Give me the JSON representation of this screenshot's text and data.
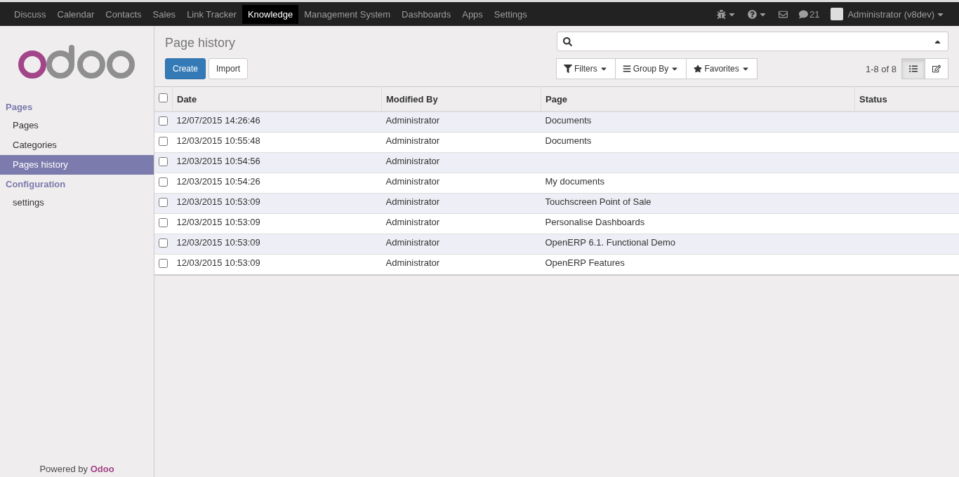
{
  "menu": [
    {
      "label": "Discuss",
      "selected": false
    },
    {
      "label": "Calendar",
      "selected": false
    },
    {
      "label": "Contacts",
      "selected": false
    },
    {
      "label": "Sales",
      "selected": false
    },
    {
      "label": "Link Tracker",
      "selected": false
    },
    {
      "label": "Knowledge",
      "selected": true
    },
    {
      "label": "Management System",
      "selected": false
    },
    {
      "label": "Dashboards",
      "selected": false
    },
    {
      "label": "Apps",
      "selected": false
    },
    {
      "label": "Settings",
      "selected": false
    }
  ],
  "systray": {
    "message_count": "21",
    "user": "Administrator (v8dev)"
  },
  "sidebar": {
    "sections": [
      {
        "title": "Pages",
        "items": [
          {
            "label": "Pages",
            "selected": false
          },
          {
            "label": "Categories",
            "selected": false
          },
          {
            "label": "Pages history",
            "selected": true
          }
        ]
      },
      {
        "title": "Configuration",
        "items": [
          {
            "label": "settings",
            "selected": false
          }
        ]
      }
    ],
    "footer": "Powered by **Odoo**"
  },
  "title": "Page history",
  "buttons": [
    "Create",
    "Import"
  ],
  "select_all": {
    "checked": false
  },
  "filters": [
    "Filters",
    "Group By",
    "Favorites"
  ],
  "pager": "1-8 of 8",
  "views": [
    {
      "kind": "list",
      "selected": true
    },
    {
      "kind": "form",
      "selected": false
    }
  ],
  "table": {
    "columns": [
      "Date",
      "Modified By",
      "Page",
      "Status"
    ],
    "rows": [
      {
        "checked": false,
        "cells": [
          "12/07/2015 14:26:46",
          "Administrator",
          "Documents",
          ""
        ]
      },
      {
        "checked": false,
        "cells": [
          "12/03/2015 10:55:48",
          "Administrator",
          "Documents",
          ""
        ]
      },
      {
        "checked": false,
        "cells": [
          "12/03/2015 10:54:56",
          "Administrator",
          "",
          ""
        ]
      },
      {
        "checked": false,
        "cells": [
          "12/03/2015 10:54:26",
          "Administrator",
          "My documents",
          ""
        ]
      },
      {
        "checked": false,
        "cells": [
          "12/03/2015 10:53:09",
          "Administrator",
          "Touchscreen Point of Sale",
          ""
        ]
      },
      {
        "checked": false,
        "cells": [
          "12/03/2015 10:53:09",
          "Administrator",
          "Personalise Dashboards",
          ""
        ]
      },
      {
        "checked": false,
        "cells": [
          "12/03/2015 10:53:09",
          "Administrator",
          "OpenERP 6.1. Functional Demo",
          ""
        ]
      },
      {
        "checked": false,
        "cells": [
          "12/03/2015 10:53:09",
          "Administrator",
          "OpenERP Features",
          ""
        ]
      }
    ]
  }
}
